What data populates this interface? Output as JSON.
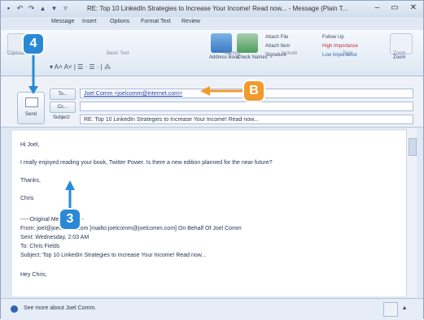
{
  "window": {
    "title": "RE: Top 10 LinkedIn Strategies to Increase Your Income!  Read now... - Message (Plain T...",
    "controls": [
      "–",
      "▭",
      "✕"
    ]
  },
  "ribbon": {
    "tabs": [
      "Message",
      "Insert",
      "Options",
      "Format Text",
      "Review"
    ],
    "clipboard_label": "Clipboard",
    "basic_text_label": "Basic Text",
    "names_label": "Names",
    "include_label": "Include",
    "tags_label": "Tags",
    "zoom_label": "Zoom",
    "address_book": "Address Book",
    "check_names": "Check Names",
    "attach_file": "Attach File",
    "attach_item": "Attach Item",
    "signature": "Signature",
    "follow_up": "Follow Up",
    "high_importance": "High Importance",
    "low_importance": "Low Importance",
    "zoom_btn": "Zoom"
  },
  "compose": {
    "send_label": "Send",
    "to_label": "To...",
    "cc_label": "Cc...",
    "subject_label": "Subject:",
    "to_value": "Joel Comm <joelcomm@internet.com>",
    "cc_value": "",
    "subject_value": "RE: Top 10 LinkedIn Strategies to Increase Your Income!  Read now..."
  },
  "body": {
    "greeting": "Hi Joel,",
    "line1": "I really enjoyed reading your book, Twitter Power.  Is there a new edition planned for the near future?",
    "thanks": "Thanks,",
    "name": "Chris",
    "orig_header": "-----Original Message-----",
    "from_line": "From: joel@joelcomm.com [mailto:joelcomm@joelcomm.com] On Behalf Of Joel Comm",
    "sent_line": "Sent: Wednesday, 2:03 AM",
    "to_line": "To: Chris Fields",
    "subject_line": "Subject: Top 10 LinkedIn Strategies to Increase Your Income!  Read now...",
    "hey": "Hey Chris,"
  },
  "status": {
    "text": "See more about Joel Comm."
  },
  "callouts": {
    "step4": "4",
    "stepB": "B",
    "step3": "3"
  },
  "colors": {
    "callout_blue": "#2a89d6",
    "callout_orange": "#f19a2d"
  }
}
